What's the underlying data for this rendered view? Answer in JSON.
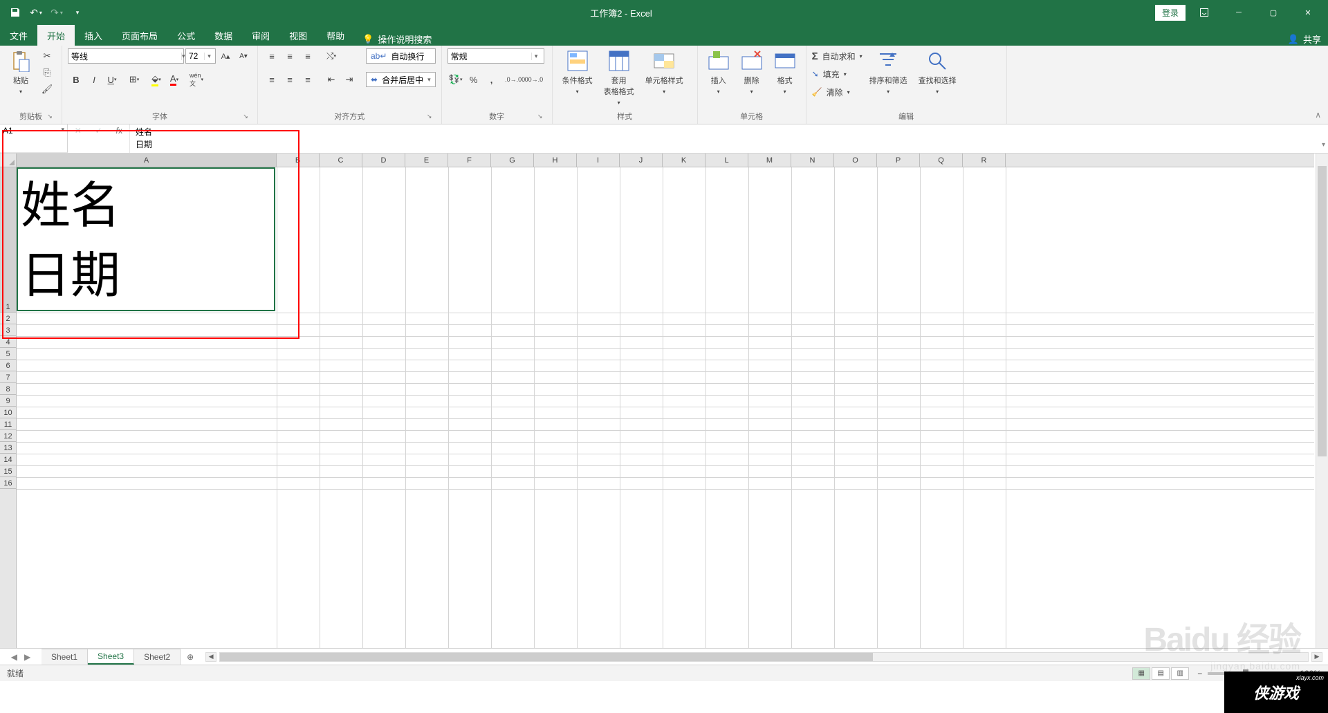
{
  "title": "工作簿2 - Excel",
  "login": "登录",
  "share": "共享",
  "tabs": [
    "文件",
    "开始",
    "插入",
    "页面布局",
    "公式",
    "数据",
    "审阅",
    "视图",
    "帮助"
  ],
  "active_tab": 1,
  "tellme": "操作说明搜索",
  "groups": {
    "clipboard": "剪贴板",
    "paste": "粘贴",
    "font": "字体",
    "alignment": "对齐方式",
    "number": "数字",
    "styles": "样式",
    "cells": "单元格",
    "editing": "编辑"
  },
  "font": {
    "name": "等线",
    "size": "72"
  },
  "alignment": {
    "wrap": "自动换行",
    "merge": "合并后居中"
  },
  "number_format": "常规",
  "styles": {
    "cond": "条件格式",
    "table": "套用\n表格格式",
    "cell": "单元格样式"
  },
  "cells_grp": {
    "insert": "插入",
    "delete": "删除",
    "format": "格式"
  },
  "editing": {
    "autosum": "自动求和",
    "fill": "填充",
    "clear": "清除",
    "sort": "排序和筛选",
    "find": "查找和选择"
  },
  "namebox": "A1",
  "formula_line1": "姓名",
  "formula_line2": "日期",
  "columns": [
    "A",
    "B",
    "C",
    "D",
    "E",
    "F",
    "G",
    "H",
    "I",
    "J",
    "K",
    "L",
    "M",
    "N",
    "O",
    "P",
    "Q",
    "R"
  ],
  "col_a_width": 376,
  "col_other_width": 62,
  "row1_height": 210,
  "row_other_height": 17,
  "row_count": 16,
  "cell_a1_line1": "姓名",
  "cell_a1_line2": "日期",
  "sheets": [
    "Sheet1",
    "Sheet3",
    "Sheet2"
  ],
  "active_sheet": 1,
  "status": "就绪",
  "zoom": "100%",
  "watermark": "Baidu 经验",
  "watermark_url": "jingyan.baidu.com",
  "corner": "侠游戏",
  "corner_url": "xiayx.com"
}
